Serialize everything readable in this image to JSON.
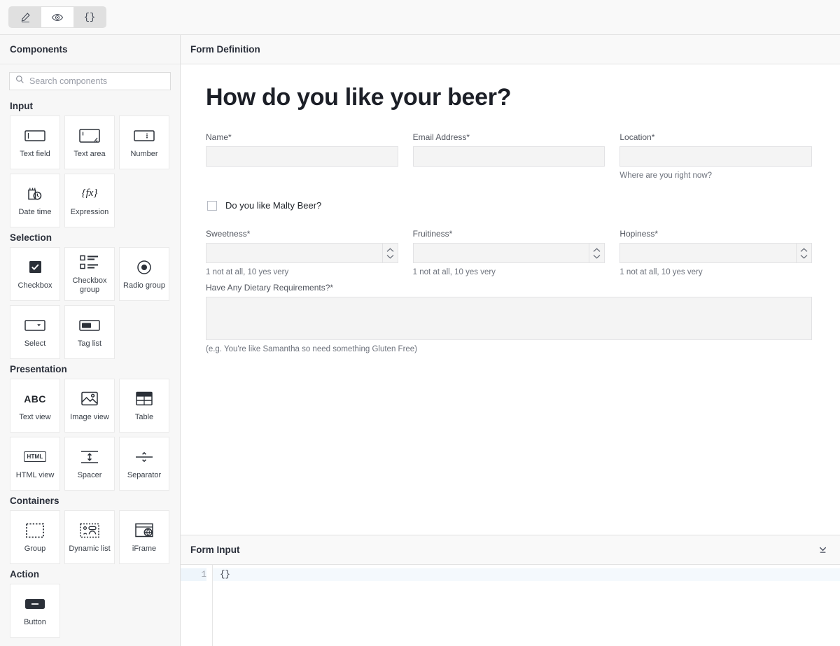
{
  "toolbar": {
    "buttons": [
      {
        "name": "edit-mode-button",
        "icon": "pencil-icon",
        "label": "Edit",
        "active": false
      },
      {
        "name": "preview-mode-button",
        "icon": "eye-icon",
        "label": "Preview",
        "active": true
      },
      {
        "name": "json-mode-button",
        "icon": "braces-icon",
        "label": "{}",
        "active": false
      }
    ]
  },
  "palette": {
    "title": "Components",
    "search": {
      "value": "",
      "placeholder": "Search components",
      "icon": "search-icon"
    },
    "groups": [
      {
        "title": "Input",
        "items": [
          {
            "label": "Text field",
            "icon": "text-field-icon"
          },
          {
            "label": "Text area",
            "icon": "text-area-icon"
          },
          {
            "label": "Number",
            "icon": "number-icon"
          },
          {
            "label": "Date time",
            "icon": "date-time-icon"
          },
          {
            "label": "Expression",
            "icon": "expression-fx-icon"
          }
        ]
      },
      {
        "title": "Selection",
        "items": [
          {
            "label": "Checkbox",
            "icon": "checkbox-icon"
          },
          {
            "label": "Checkbox group",
            "icon": "checkbox-group-icon"
          },
          {
            "label": "Radio group",
            "icon": "radio-group-icon"
          },
          {
            "label": "Select",
            "icon": "select-icon"
          },
          {
            "label": "Tag list",
            "icon": "tag-list-icon"
          }
        ]
      },
      {
        "title": "Presentation",
        "items": [
          {
            "label": "Text view",
            "icon": "text-view-abc-icon"
          },
          {
            "label": "Image view",
            "icon": "image-view-icon"
          },
          {
            "label": "Table",
            "icon": "table-icon"
          },
          {
            "label": "HTML view",
            "icon": "html-view-icon"
          },
          {
            "label": "Spacer",
            "icon": "spacer-icon"
          },
          {
            "label": "Separator",
            "icon": "separator-icon"
          }
        ]
      },
      {
        "title": "Containers",
        "items": [
          {
            "label": "Group",
            "icon": "group-icon"
          },
          {
            "label": "Dynamic list",
            "icon": "dynamic-list-icon"
          },
          {
            "label": "iFrame",
            "icon": "iframe-icon"
          }
        ]
      },
      {
        "title": "Action",
        "items": [
          {
            "label": "Button",
            "icon": "button-icon"
          }
        ]
      }
    ]
  },
  "form_definition": {
    "header": "Form Definition",
    "title": "How do you like your beer?",
    "rows": [
      {
        "fields": [
          {
            "label": "Name*",
            "value": "",
            "help": "",
            "control": "text"
          },
          {
            "label": "Email Address*",
            "value": "",
            "help": "",
            "control": "text"
          },
          {
            "label": "Location*",
            "value": "",
            "help": "Where are you right now?",
            "control": "text"
          }
        ]
      },
      {
        "checkbox": {
          "label": "Do you like Malty Beer?",
          "checked": false
        }
      },
      {
        "fields": [
          {
            "label": "Sweetness*",
            "value": "",
            "help": "1 not at all, 10 yes very",
            "control": "number"
          },
          {
            "label": "Fruitiness*",
            "value": "",
            "help": "1 not at all, 10 yes very",
            "control": "number"
          },
          {
            "label": "Hopiness*",
            "value": "",
            "help": "1 not at all, 10 yes very",
            "control": "number"
          }
        ]
      },
      {
        "fields": [
          {
            "label": "Have Any Dietary Requirements?*",
            "value": "",
            "help": "(e.g. You're like Samantha so need something Gluten Free)",
            "control": "textarea"
          }
        ]
      }
    ]
  },
  "form_input": {
    "header": "Form Input",
    "collapse_icon": "collapse-down-icon",
    "code_lines": [
      {
        "number": "1",
        "text": "{}"
      }
    ]
  },
  "colors": {
    "page_bg": "#ffffff",
    "panel_bg": "#f7f7f7",
    "header_bg": "#f9f9f9",
    "border": "#e0e0e0",
    "input_fill": "#f4f4f4",
    "text": "#21252b",
    "muted_text": "#6d727c",
    "active_line": "#f4f9fd"
  }
}
